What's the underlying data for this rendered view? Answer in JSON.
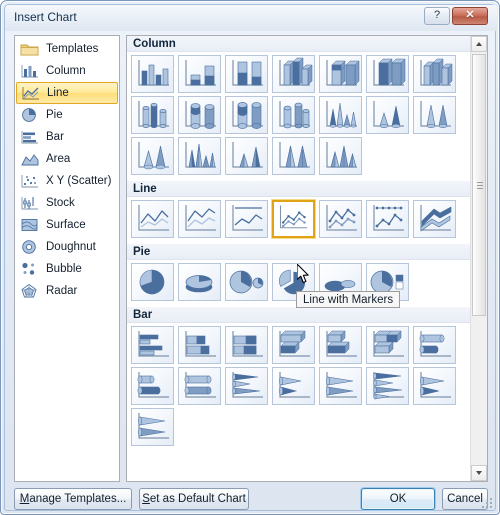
{
  "window": {
    "title": "Insert Chart",
    "help_label": "?",
    "close_label": "✕"
  },
  "sidebar": {
    "items": [
      {
        "label": "Templates",
        "icon": "folder-icon",
        "selected": false
      },
      {
        "label": "Column",
        "icon": "column-chart-icon",
        "selected": false
      },
      {
        "label": "Line",
        "icon": "line-chart-icon",
        "selected": true
      },
      {
        "label": "Pie",
        "icon": "pie-chart-icon",
        "selected": false
      },
      {
        "label": "Bar",
        "icon": "bar-chart-icon",
        "selected": false
      },
      {
        "label": "Area",
        "icon": "area-chart-icon",
        "selected": false
      },
      {
        "label": "X Y (Scatter)",
        "icon": "scatter-chart-icon",
        "selected": false
      },
      {
        "label": "Stock",
        "icon": "stock-chart-icon",
        "selected": false
      },
      {
        "label": "Surface",
        "icon": "surface-chart-icon",
        "selected": false
      },
      {
        "label": "Doughnut",
        "icon": "doughnut-chart-icon",
        "selected": false
      },
      {
        "label": "Bubble",
        "icon": "bubble-chart-icon",
        "selected": false
      },
      {
        "label": "Radar",
        "icon": "radar-chart-icon",
        "selected": false
      }
    ]
  },
  "gallery": {
    "sections": [
      {
        "title": "Column",
        "rows": [
          [
            "clustered-column",
            "stacked-column",
            "100-stacked-column",
            "3d-clustered-column",
            "3d-stacked-column",
            "3d-100-stacked-column",
            "3d-column"
          ],
          [
            "clustered-cylinder",
            "stacked-cylinder",
            "100-stacked-cylinder",
            "3d-cylinder",
            "clustered-cone",
            "stacked-cone",
            "100-stacked-cone"
          ],
          [
            "3d-cone",
            "clustered-pyramid",
            "stacked-pyramid",
            "100-stacked-pyramid",
            "3d-pyramid"
          ]
        ]
      },
      {
        "title": "Line",
        "rows": [
          [
            "line",
            "stacked-line",
            "100-stacked-line",
            "line-with-markers",
            "stacked-line-with-markers",
            "100-stacked-line-with-markers",
            "3d-line"
          ]
        ]
      },
      {
        "title": "Pie",
        "rows": [
          [
            "pie",
            "pie-3d",
            "pie-of-pie",
            "exploded-pie",
            "exploded-pie-3d",
            "bar-of-pie"
          ]
        ]
      },
      {
        "title": "Bar",
        "rows": [
          [
            "clustered-bar",
            "stacked-bar",
            "100-stacked-bar",
            "3d-clustered-bar",
            "3d-stacked-bar",
            "3d-100-stacked-bar",
            "horizontal-cylinder"
          ],
          [
            "stacked-cylinder-bar",
            "100-stacked-cylinder-bar",
            "clustered-cone-bar",
            "stacked-cone-bar",
            "100-stacked-cone-bar",
            "clustered-pyramid-bar",
            "stacked-pyramid-bar"
          ],
          [
            "100-stacked-pyramid-bar"
          ]
        ]
      }
    ],
    "selected_section": "Line",
    "selected_index": 3
  },
  "tooltip": {
    "text": "Line with Markers"
  },
  "scrollbar": {
    "up_arrow": "scroll-up-arrow",
    "down_arrow": "scroll-down-arrow"
  },
  "buttons": {
    "manage_templates": "Manage Templates...",
    "manage_templates_accel": "M",
    "set_as_default": "Set as Default Chart",
    "set_as_default_accel": "S",
    "ok": "OK",
    "cancel": "Cancel"
  },
  "colors": {
    "selection_gold": "#e0a317",
    "selection_gold_fill": "#ffe997",
    "chart_blue": "#4a6f9e",
    "chart_blue_light": "#aec4df",
    "titlebar_text": "#16304e",
    "close_red": "#b75b46",
    "focus_blue": "#3c7fb1"
  }
}
